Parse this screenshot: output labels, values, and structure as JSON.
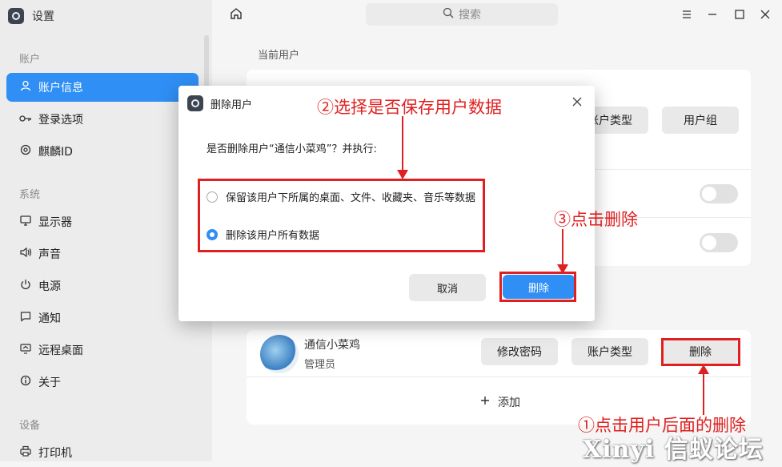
{
  "app": {
    "title": "设置"
  },
  "search": {
    "placeholder": "搜索"
  },
  "sidebar": {
    "groups": [
      {
        "label": "账户"
      },
      {
        "label": "系统"
      },
      {
        "label": "设备"
      }
    ],
    "items": [
      {
        "label": "账户信息",
        "icon": "user-icon",
        "active": true
      },
      {
        "label": "登录选项",
        "icon": "key-icon"
      },
      {
        "label": "麒麟ID",
        "icon": "kylin-id-icon"
      },
      {
        "label": "显示器",
        "icon": "monitor-icon"
      },
      {
        "label": "声音",
        "icon": "speaker-icon"
      },
      {
        "label": "电源",
        "icon": "power-icon"
      },
      {
        "label": "通知",
        "icon": "notification-icon"
      },
      {
        "label": "远程桌面",
        "icon": "remote-desktop-icon"
      },
      {
        "label": "关于",
        "icon": "info-icon"
      },
      {
        "label": "打印机",
        "icon": "printer-icon"
      }
    ]
  },
  "main": {
    "current_user_title": "当前用户",
    "current_user": {
      "account_type_btn": "账户类型",
      "user_group_btn": "用户组"
    },
    "other_user": {
      "name": "通信小菜鸡",
      "role": "管理员",
      "change_password_btn": "修改密码",
      "account_type_btn": "账户类型",
      "delete_btn": "删除"
    },
    "add_label": "添加"
  },
  "dialog": {
    "title": "删除用户",
    "question": "是否删除用户“通信小菜鸡”？并执行:",
    "options": [
      {
        "label": "保留该用户下所属的桌面、文件、收藏夹、音乐等数据",
        "checked": false
      },
      {
        "label": "删除该用户所有数据",
        "checked": true
      }
    ],
    "cancel_btn": "取消",
    "delete_btn": "删除"
  },
  "annotations": {
    "step1": "①点击用户后面的删除",
    "step2": "②选择是否保存用户数据",
    "step3": "③点击删除",
    "color": "#e02020"
  },
  "watermark": "Xinyi 信蚁论坛",
  "colors": {
    "accent": "#2f8ff5",
    "sidebar_bg": "#ececec"
  }
}
